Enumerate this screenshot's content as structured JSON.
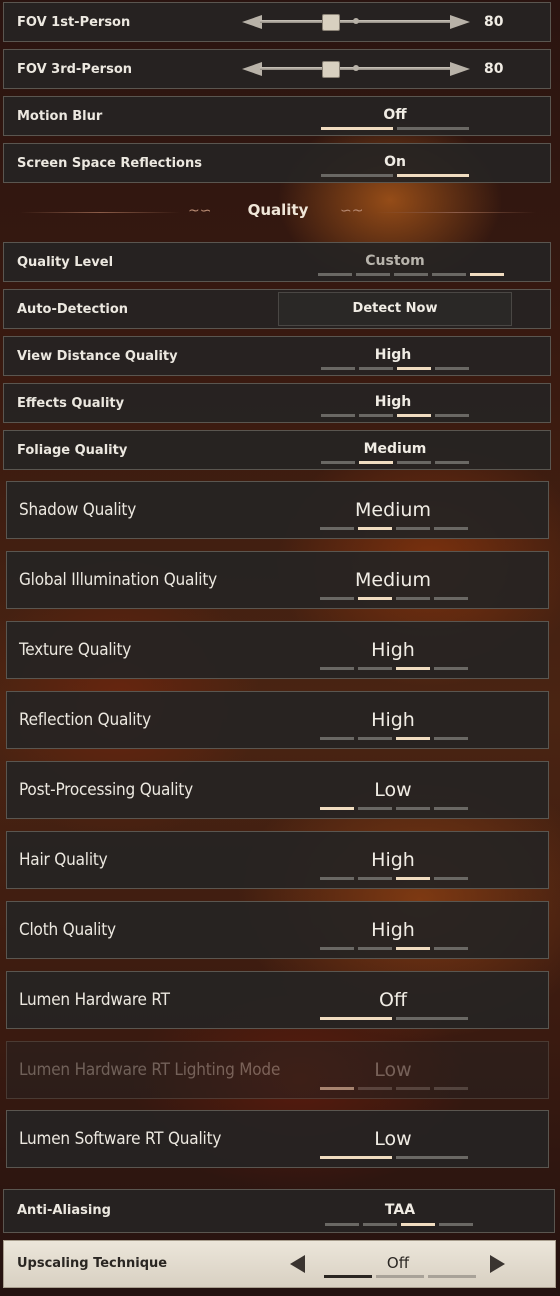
{
  "fov1": {
    "label": "FOV 1st-Person",
    "value": "80",
    "level": 0.5
  },
  "fov3": {
    "label": "FOV 3rd-Person",
    "value": "80",
    "level": 0.5
  },
  "motion_blur": {
    "label": "Motion Blur",
    "value": "Off",
    "selected": 1,
    "steps": 2
  },
  "ssr": {
    "label": "Screen Space Reflections",
    "value": "On",
    "selected": 2,
    "steps": 2
  },
  "quality_header": {
    "title": "Quality"
  },
  "quality_level": {
    "label": "Quality Level",
    "value": "Custom",
    "selected": 5,
    "steps": 5
  },
  "auto_detection": {
    "label": "Auto-Detection",
    "button": "Detect Now"
  },
  "view_distance": {
    "label": "View Distance Quality",
    "value": "High",
    "selected": 3,
    "steps": 4
  },
  "effects": {
    "label": "Effects Quality",
    "value": "High",
    "selected": 3,
    "steps": 4
  },
  "foliage": {
    "label": "Foliage Quality",
    "value": "Medium",
    "selected": 2,
    "steps": 4
  },
  "shadow": {
    "label": "Shadow Quality",
    "value": "Medium",
    "selected": 2,
    "steps": 4
  },
  "gi": {
    "label": "Global Illumination Quality",
    "value": "Medium",
    "selected": 2,
    "steps": 4
  },
  "texture": {
    "label": "Texture Quality",
    "value": "High",
    "selected": 3,
    "steps": 4
  },
  "reflection": {
    "label": "Reflection Quality",
    "value": "High",
    "selected": 3,
    "steps": 4
  },
  "post_processing": {
    "label": "Post-Processing Quality",
    "value": "Low",
    "selected": 1,
    "steps": 4
  },
  "hair": {
    "label": "Hair Quality",
    "value": "High",
    "selected": 3,
    "steps": 4
  },
  "cloth": {
    "label": "Cloth Quality",
    "value": "High",
    "selected": 3,
    "steps": 4
  },
  "lumen_hw_rt": {
    "label": "Lumen Hardware RT",
    "value": "Off",
    "selected": 1,
    "steps": 2
  },
  "lumen_hw_rt_lighting": {
    "label": "Lumen Hardware RT Lighting Mode",
    "value": "Low",
    "selected": 1,
    "steps": 4
  },
  "lumen_sw_rt": {
    "label": "Lumen Software RT Quality",
    "value": "Low",
    "selected": 1,
    "steps": 2
  },
  "anti_aliasing": {
    "label": "Anti-Aliasing",
    "value": "TAA",
    "selected": 3,
    "steps": 4
  },
  "upscaling": {
    "label": "Upscaling Technique",
    "value": "Off",
    "selected": 1,
    "steps": 3
  }
}
